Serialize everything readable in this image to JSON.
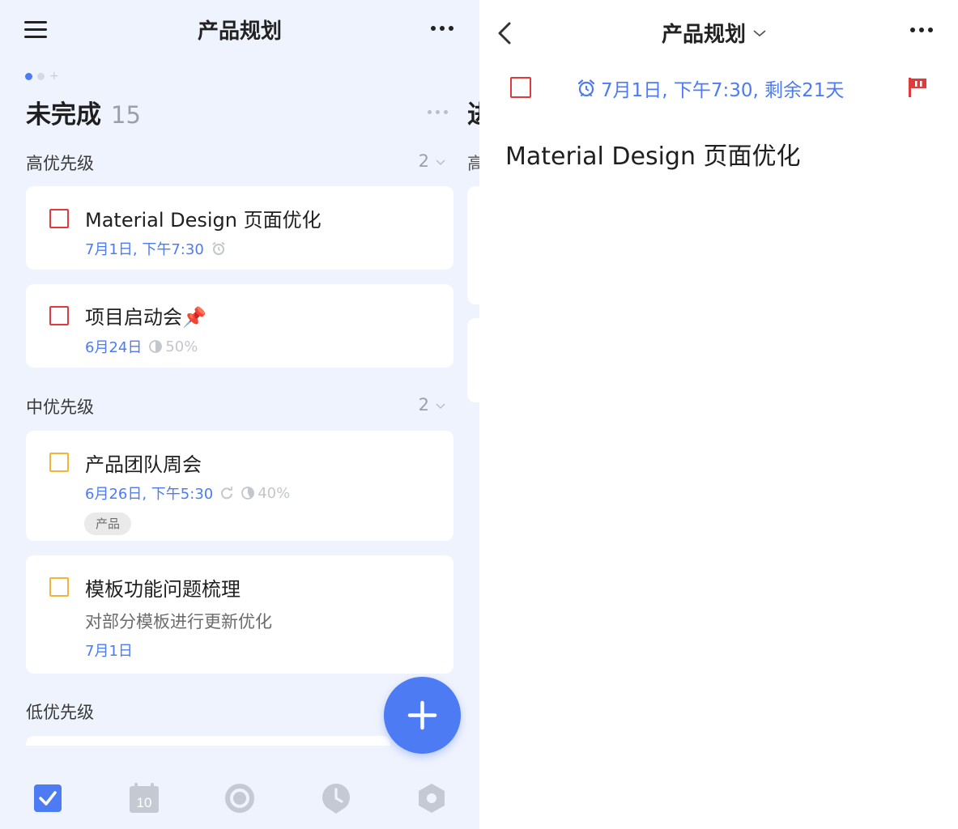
{
  "left_header": {
    "title": "产品规划"
  },
  "column": {
    "title": "未完成",
    "count": "15"
  },
  "next_column": {
    "title_peek": "进",
    "section_peek": "高"
  },
  "sections": [
    {
      "label": "高优先级",
      "count": "2"
    },
    {
      "label": "中优先级",
      "count": "2"
    },
    {
      "label": "低优先级"
    }
  ],
  "tasks": [
    {
      "title": "Material Design 页面优化",
      "date": "7月1日, 下午7:30",
      "priority": "high"
    },
    {
      "title": "项目启动会📌",
      "date": "6月24日",
      "progress": "50%",
      "priority": "high"
    },
    {
      "title": "产品团队周会",
      "date": "6月26日, 下午5:30",
      "progress": "40%",
      "tag": "产品",
      "priority": "medium"
    },
    {
      "title": "模板功能问题梳理",
      "description": "对部分模板进行更新优化",
      "date": "7月1日",
      "priority": "medium"
    }
  ],
  "tabbar": {
    "items": [
      "tasks-icon",
      "calendar-icon",
      "focus-icon",
      "clock-icon",
      "settings-icon"
    ],
    "calendar_day": "10"
  },
  "detail": {
    "header_title": "产品规划",
    "due": "7月1日, 下午7:30, 剩余21天",
    "title": "Material Design 页面优化"
  },
  "colors": {
    "accent": "#4c7bf3",
    "priority_high": "#e03b3b",
    "priority_medium": "#f2b537",
    "left_background": "#eff3fd"
  }
}
